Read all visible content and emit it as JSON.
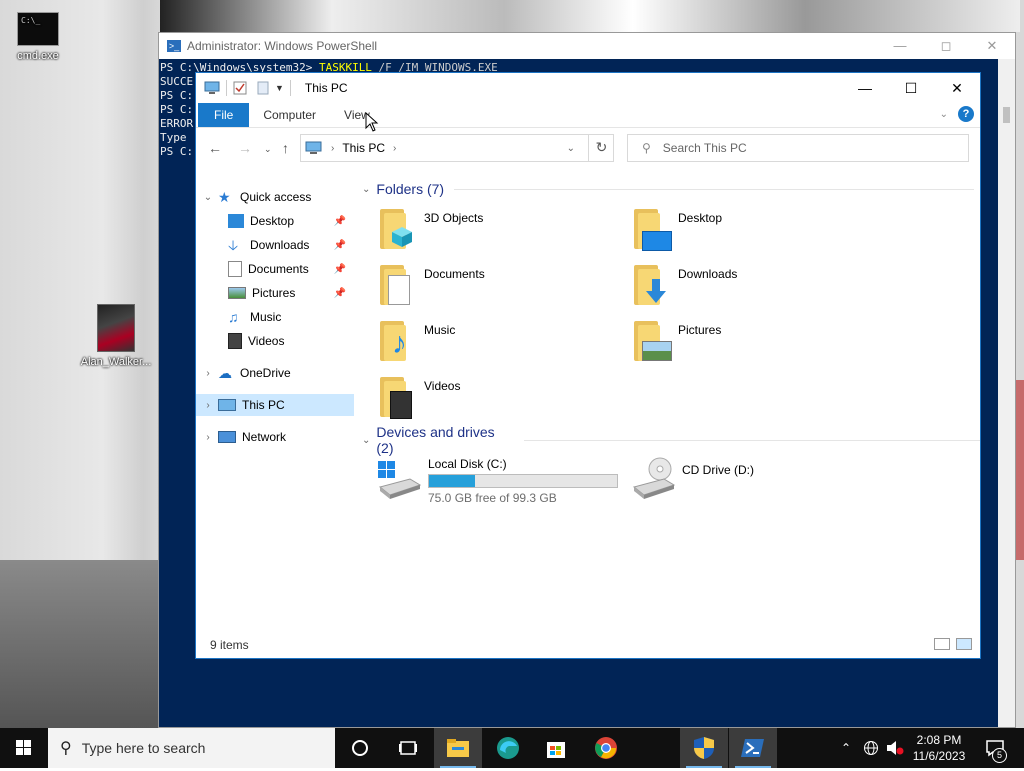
{
  "desktop": {
    "icons": [
      {
        "label": "cmd.exe"
      },
      {
        "label": "Alan_Walker..."
      }
    ]
  },
  "powershell": {
    "title": "Administrator: Windows PowerShell",
    "lines": [
      {
        "prompt": "PS C:\\Windows\\system32> ",
        "cmd": "TASKKILL",
        "args": " /F /IM WINDOWS.EXE"
      },
      {
        "prompt": "SUCCE",
        "cmd": "",
        "args": ""
      },
      {
        "prompt": "PS C:",
        "cmd": "",
        "args": ""
      },
      {
        "prompt": "PS C:",
        "cmd": "",
        "args": ""
      },
      {
        "prompt": "ERROR",
        "cmd": "",
        "args": ""
      },
      {
        "prompt": "Type",
        "cmd": "",
        "args": ""
      },
      {
        "prompt": "PS C:",
        "cmd": "",
        "args": ""
      }
    ]
  },
  "explorer": {
    "title": "This PC",
    "ribbon_tabs": [
      "File",
      "Computer",
      "View"
    ],
    "breadcrumb": "This PC",
    "search_placeholder": "Search This PC",
    "sidebar": {
      "quick_access": "Quick access",
      "quick_items": [
        {
          "label": "Desktop",
          "pinned": true
        },
        {
          "label": "Downloads",
          "pinned": true
        },
        {
          "label": "Documents",
          "pinned": true
        },
        {
          "label": "Pictures",
          "pinned": true
        },
        {
          "label": "Music",
          "pinned": false
        },
        {
          "label": "Videos",
          "pinned": false
        }
      ],
      "onedrive": "OneDrive",
      "this_pc": "This PC",
      "network": "Network"
    },
    "folders_header": "Folders (7)",
    "folders": [
      "3D Objects",
      "Desktop",
      "Documents",
      "Downloads",
      "Music",
      "Pictures",
      "Videos"
    ],
    "devices_header": "Devices and drives (2)",
    "drives": [
      {
        "name": "Local Disk (C:)",
        "free_text": "75.0 GB free of 99.3 GB",
        "used_fraction": 0.245
      },
      {
        "name": "CD Drive (D:)"
      }
    ],
    "status": "9 items"
  },
  "taskbar": {
    "search_placeholder": "Type here to search",
    "time": "2:08 PM",
    "date": "11/6/2023",
    "notification_count": "5"
  }
}
